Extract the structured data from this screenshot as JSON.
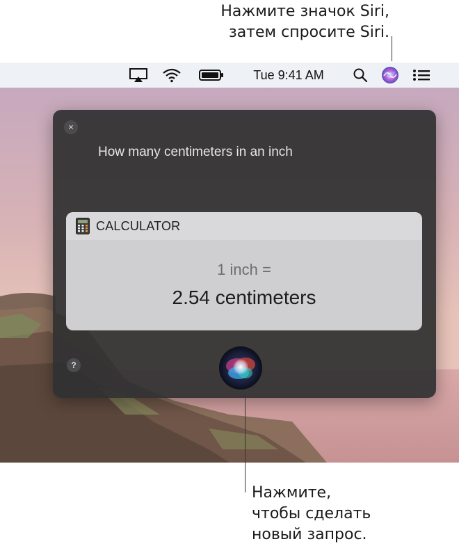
{
  "callouts": {
    "top_line1": "Нажмите значок Siri,",
    "top_line2": "затем спросите Siri.",
    "bottom_line1": "Нажмите,",
    "bottom_line2": "чтобы сделать",
    "bottom_line3": "новый запрос."
  },
  "menubar": {
    "clock": "Tue 9:41 AM",
    "icons": [
      "airplay-icon",
      "wifi-icon",
      "battery-icon",
      "spotlight-search-icon",
      "siri-icon",
      "notification-center-icon"
    ]
  },
  "siri": {
    "close_label": "×",
    "help_label": "?",
    "query": "How many centimeters in an inch",
    "card": {
      "app_name": "CALCULATOR",
      "line1": "1 inch =",
      "line2": "2.54 centimeters"
    }
  },
  "colors": {
    "panel_bg": "#303032",
    "card_bg": "#cfcfd1",
    "menubar_bg": "#eef1f6"
  }
}
